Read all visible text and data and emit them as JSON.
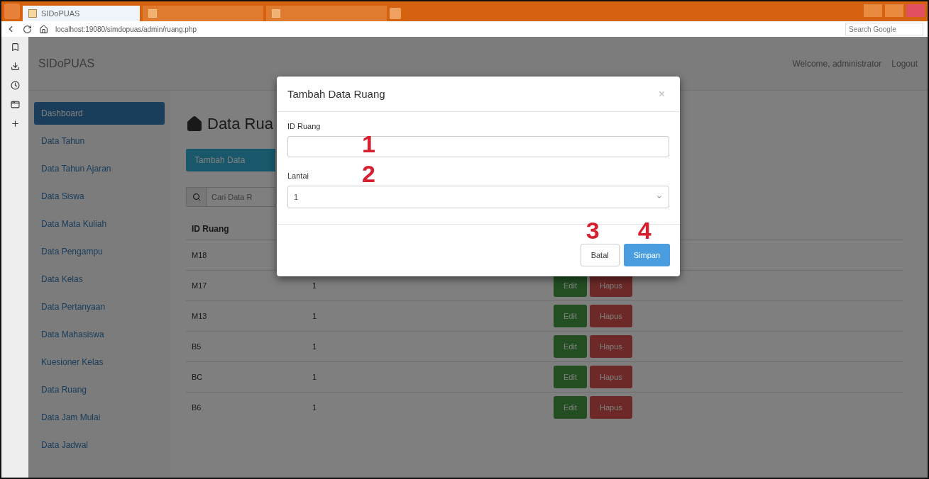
{
  "browser": {
    "tabs": [
      {
        "label": "SIDoPUAS",
        "selected": true
      },
      {
        "selected": false
      },
      {
        "selected": false
      }
    ],
    "url": "localhost:19080/simdopuas/admin/ruang.php",
    "search": {
      "placeholder": "Search Google"
    }
  },
  "navbar": {
    "brand": "SIDoPUAS",
    "user": "Welcome, administrator",
    "logout": "Logout"
  },
  "sidebar": {
    "items": [
      {
        "label": "Dashboard",
        "selected": true
      },
      {
        "label": "Data Tahun",
        "selected": false
      },
      {
        "label": "Data Tahun Ajaran",
        "selected": false
      },
      {
        "label": "Data Siswa",
        "selected": false
      },
      {
        "label": "Data Mata Kuliah",
        "selected": false
      },
      {
        "label": "Data Pengampu",
        "selected": false
      },
      {
        "label": "Data Kelas",
        "selected": false
      },
      {
        "label": "Data Pertanyaan",
        "selected": false
      },
      {
        "label": "Data Mahasiswa",
        "selected": false
      },
      {
        "label": "Kuesioner Kelas",
        "selected": false
      },
      {
        "label": "Data Ruang",
        "selected": false
      },
      {
        "label": "Data Jam Mulai",
        "selected": false
      },
      {
        "label": "Data Jadwal",
        "selected": false
      }
    ]
  },
  "page": {
    "title": "Data Rua",
    "add_button": "Tambah Data",
    "search_placeholder": "Cari Data R",
    "table": {
      "columns": [
        "ID Ruang"
      ],
      "rows": [
        {
          "id": "M18"
        },
        {
          "id": "M17",
          "lantai": "1",
          "edit": "Edit",
          "delete": "Hapus"
        },
        {
          "id": "M13",
          "lantai": "1",
          "edit": "Edit",
          "delete": "Hapus"
        },
        {
          "id": "B5",
          "lantai": "1",
          "edit": "Edit",
          "delete": "Hapus"
        },
        {
          "id": "BC",
          "lantai": "1",
          "edit": "Edit",
          "delete": "Hapus"
        },
        {
          "id": "B6",
          "lantai": "1",
          "edit": "Edit",
          "delete": "Hapus"
        }
      ]
    }
  },
  "modal": {
    "title": "Tambah Data Ruang",
    "close": "×",
    "fields": [
      {
        "label": "ID Ruang",
        "kind": "text",
        "marker": "1"
      },
      {
        "label": "Lantai",
        "kind": "select",
        "value": "1",
        "marker": "2"
      }
    ],
    "cancel": {
      "label": "Batal",
      "marker": "3"
    },
    "save": {
      "label": "Simpan",
      "marker": "4"
    }
  }
}
